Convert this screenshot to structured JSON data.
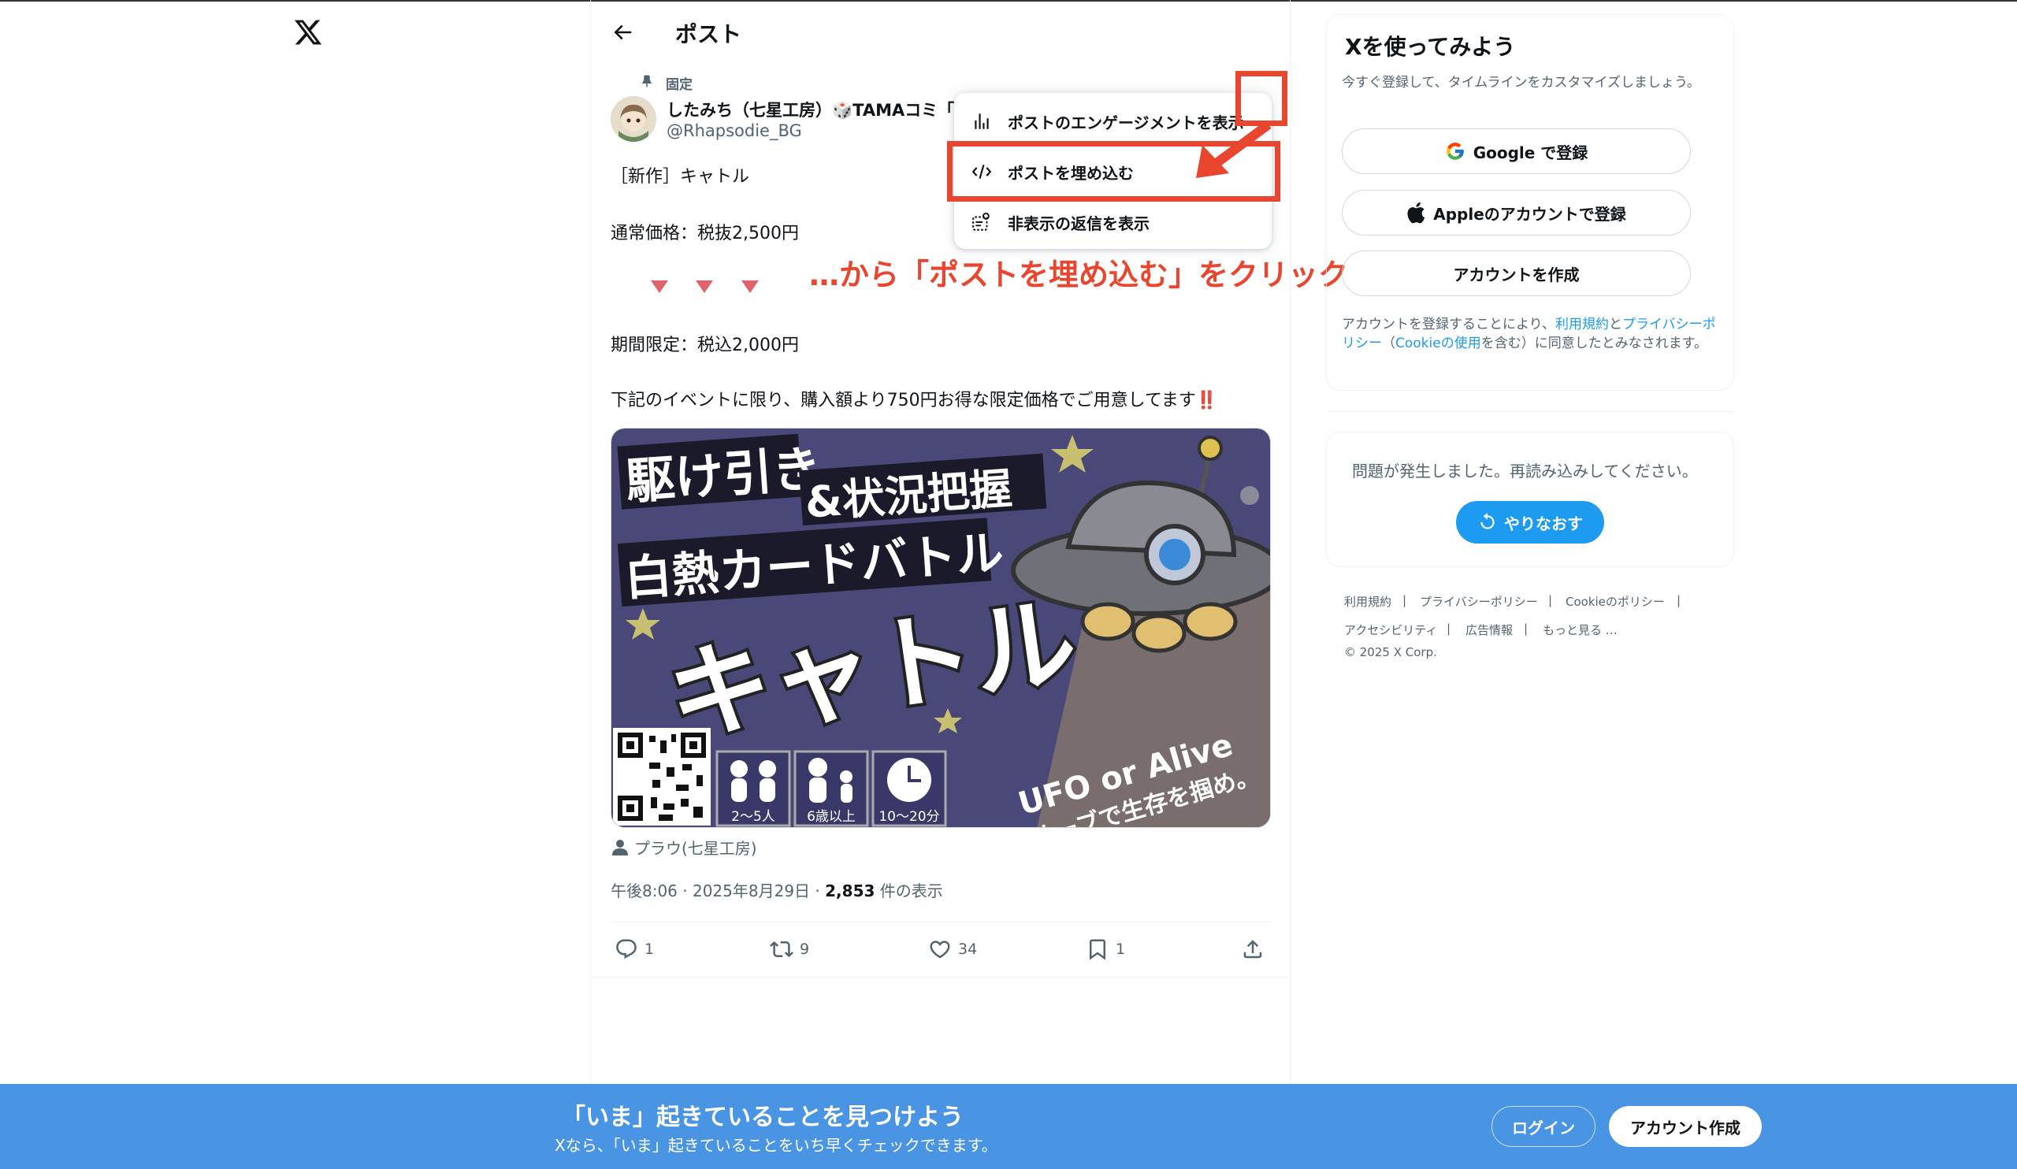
{
  "header": {
    "title": "ポスト"
  },
  "post": {
    "pinned_label": "固定",
    "author_name": "したみち（七星工房）🎲TAMAコミ「",
    "author_handle": "@Rhapsodie_BG",
    "line1": "［新作］キャトル",
    "line2": "通常価格：税抜2,500円",
    "line3": "期間限定：税込2,000円",
    "line4": "下記のイベントに限り、購入額より750円お得な限定価格でご用意してます",
    "line4_emoji": "‼️",
    "tagged_user": "プラウ(七星工房)",
    "timestamp": "午後8:06 · 2025年8月29日 · ",
    "views_count": "2,853",
    "views_label": " 件の表示",
    "actions": {
      "reply": "1",
      "retweet": "9",
      "like": "34",
      "bookmark": "1"
    }
  },
  "media": {
    "title1": "駆け引き",
    "title2": "&状況把握",
    "title3": "白熱カードバトル",
    "big_title": "キャトル",
    "ufo_line1": "UFO or Alive",
    "ufo_line2": "オーブで生存を掴め。",
    "players": "2〜5人",
    "age": "6歳以上",
    "time": "10〜20分"
  },
  "menu": {
    "items": [
      "ポストのエンゲージメントを表示",
      "ポストを埋め込む",
      "非表示の返信を表示"
    ]
  },
  "annotation": {
    "text": "…から「ポストを埋め込む」をクリック"
  },
  "sidebar": {
    "title": "Xを使ってみよう",
    "desc": "今すぐ登録して、タイムラインをカスタマイズしましょう。",
    "google_button": "Google で登録",
    "apple_button": "Appleのアカウントで登録",
    "create_button": "アカウントを作成",
    "legal_1": "アカウントを登録することにより、",
    "legal_terms": "利用規約",
    "legal_and": "と",
    "legal_privacy": "プライバシーポリシー",
    "legal_open": "（",
    "legal_cookie": "Cookieの使用",
    "legal_2": "を含む）に同意したとみなされます。",
    "error_text": "問題が発生しました。再読み込みしてください。",
    "retry_button": "やりなおす",
    "footer_links": [
      "利用規約",
      "プライバシーポリシー",
      "Cookieのポリシー",
      "アクセシビリティ",
      "広告情報",
      "もっと見る …"
    ],
    "copyright": "© 2025 X Corp."
  },
  "bottom_bar": {
    "title": "「いま」起きていることを見つけよう",
    "subtitle": "Xなら、「いま」起きていることをいち早くチェックできます。",
    "login": "ログイン",
    "signup": "アカウント作成"
  },
  "colors": {
    "accent": "#1d9bf0",
    "annotation": "#e8462f",
    "bottom_bar": "#4a95e3"
  }
}
